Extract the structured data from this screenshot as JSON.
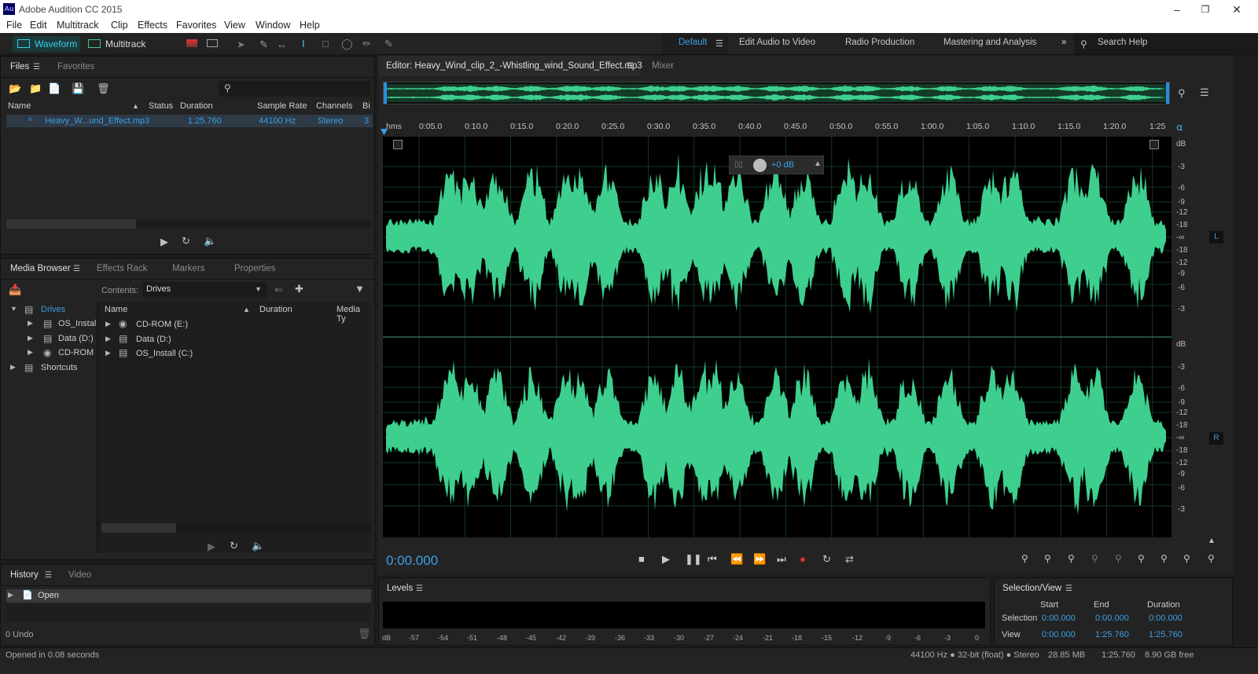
{
  "app": {
    "title": "Adobe Audition CC 2015",
    "logo": "Au"
  },
  "menu": [
    "File",
    "Edit",
    "Multitrack",
    "Clip",
    "Effects",
    "Favorites",
    "View",
    "Window",
    "Help"
  ],
  "toolbar": {
    "waveform": "Waveform",
    "multitrack": "Multitrack"
  },
  "workspaces": {
    "default": "Default",
    "edit_video": "Edit Audio to Video",
    "radio": "Radio Production",
    "mastering": "Mastering and Analysis",
    "search": "Search Help"
  },
  "files_panel": {
    "tab_files": "Files",
    "tab_favorites": "Favorites",
    "columns": [
      "Name",
      "Status",
      "Duration",
      "Sample Rate",
      "Channels",
      "Bi"
    ],
    "row": {
      "name": "Heavy_W...und_Effect.mp3",
      "duration": "1:25.760",
      "sample_rate": "44100 Hz",
      "channels": "Stereo",
      "bits": "3"
    }
  },
  "media_panel": {
    "tabs": [
      "Media Browser",
      "Effects Rack",
      "Markers",
      "Properties"
    ],
    "contents_label": "Contents:",
    "contents_value": "Drives",
    "tree": [
      "Drives",
      "OS_Instal",
      "Data (D:)",
      "CD-ROM",
      "Shortcuts"
    ],
    "columns": [
      "Name",
      "Duration",
      "Media Ty"
    ],
    "items": [
      "CD-ROM (E:)",
      "Data (D:)",
      "OS_Install (C:)"
    ]
  },
  "history_panel": {
    "tab_history": "History",
    "tab_video": "Video",
    "item": "Open",
    "undo": "0 Undo"
  },
  "editor": {
    "tab": "Editor: Heavy_Wind_clip_2_-Whistling_wind_Sound_Effect.mp3",
    "mixer": "Mixer",
    "ruler": [
      "hms",
      "0:05.0",
      "0:10.0",
      "0:15.0",
      "0:20.0",
      "0:25.0",
      "0:30.0",
      "0:35.0",
      "0:40.0",
      "0:45.0",
      "0:50.0",
      "0:55.0",
      "1:00.0",
      "1:05.0",
      "1:10.0",
      "1:15.0",
      "1:20.0",
      "1:25"
    ],
    "gain": "+0 dB",
    "db_scale": [
      "dB",
      "-3",
      "-6",
      "-9",
      "-12",
      "-18",
      "-∞",
      "-18",
      "-12",
      "-9",
      "-6",
      "-3"
    ],
    "channel_left": "L",
    "channel_right": "R",
    "time": "0:00.000",
    "wave_color": "#3ecf8e"
  },
  "levels": {
    "title": "Levels",
    "scale": [
      "dB",
      "-57",
      "-54",
      "-51",
      "-48",
      "-45",
      "-42",
      "-39",
      "-36",
      "-33",
      "-30",
      "-27",
      "-24",
      "-21",
      "-18",
      "-15",
      "-12",
      "-9",
      "-6",
      "-3",
      "0"
    ]
  },
  "selection_view": {
    "title": "Selection/View",
    "cols": [
      "Start",
      "End",
      "Duration"
    ],
    "selection": {
      "label": "Selection",
      "start": "0:00.000",
      "end": "0:00.000",
      "duration": "0:00.000"
    },
    "view": {
      "label": "View",
      "start": "0:00.000",
      "end": "1:25.760",
      "duration": "1:25.760"
    }
  },
  "status": {
    "left": "Opened in 0.08 seconds",
    "format": "44100 Hz ● 32-bit (float) ● Stereo",
    "size": "28.85 MB",
    "duration": "1:25.760",
    "free": "8.90 GB free"
  }
}
